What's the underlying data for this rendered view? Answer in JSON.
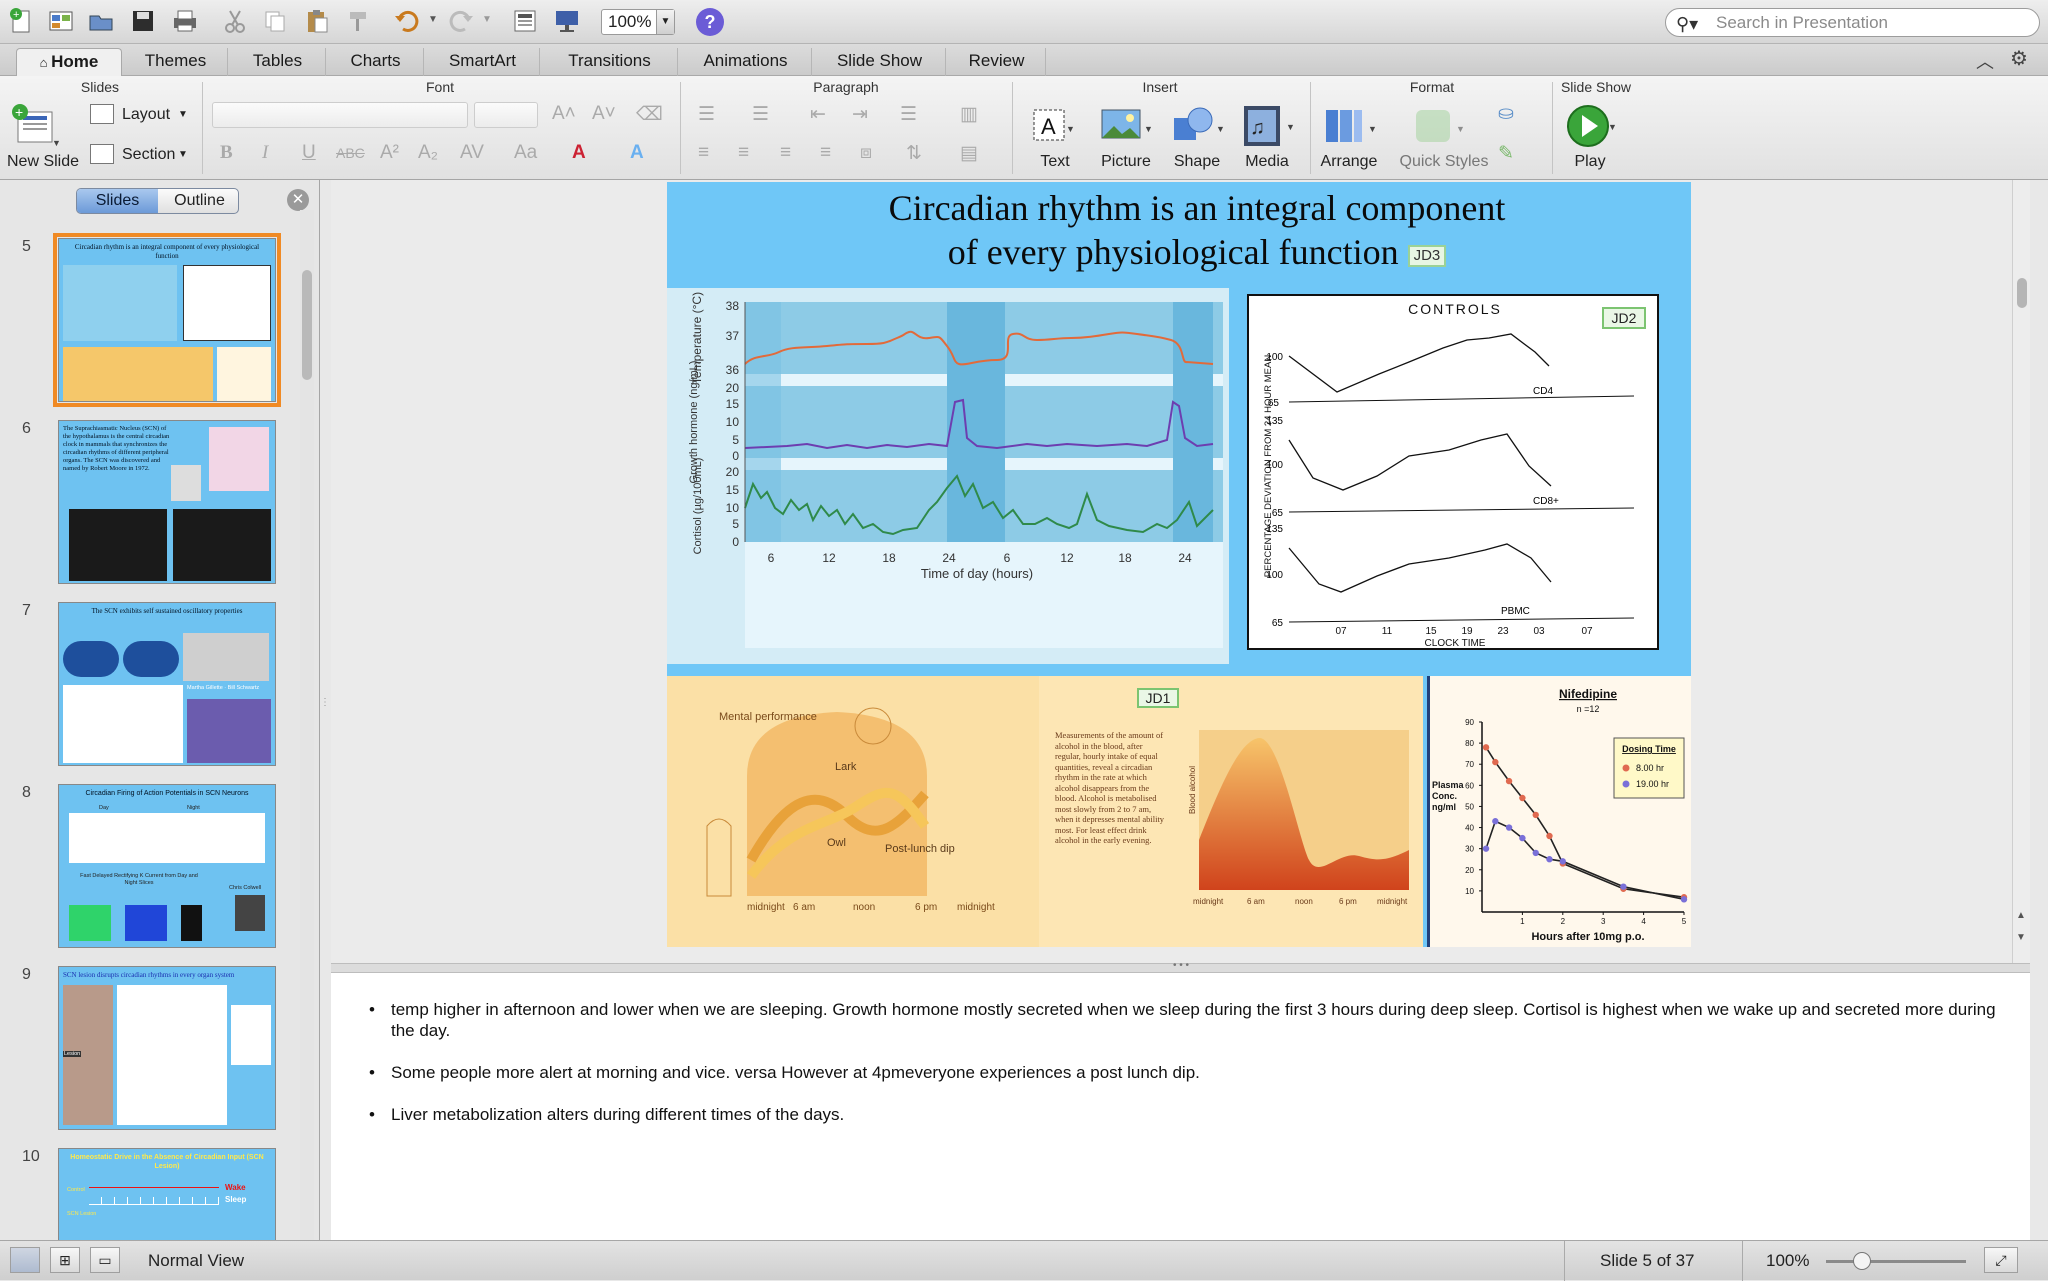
{
  "toolbar": {
    "zoom": "100%",
    "help_label": "?",
    "search_placeholder": "Search in Presentation",
    "icons": [
      "new-icon",
      "template-icon",
      "open-icon",
      "save-icon",
      "print-icon",
      "cut-icon",
      "copy-icon",
      "paste-icon",
      "format-painter-icon",
      "undo-icon",
      "redo-icon",
      "slide-layout-icon",
      "slideshow-icon"
    ]
  },
  "tabs": [
    "Home",
    "Themes",
    "Tables",
    "Charts",
    "SmartArt",
    "Transitions",
    "Animations",
    "Slide Show",
    "Review"
  ],
  "ribbon": {
    "groups": {
      "slides": "Slides",
      "font": "Font",
      "paragraph": "Paragraph",
      "insert": "Insert",
      "format": "Format",
      "slideshow": "Slide Show"
    },
    "new_slide": "New Slide",
    "layout": "Layout",
    "section": "Section",
    "font_buttons": {
      "bold": "B",
      "italic": "I",
      "underline": "U",
      "strike": "ABC",
      "superscript": "A²",
      "subscript": "A₂"
    },
    "insert_items": [
      "Text",
      "Picture",
      "Shape",
      "Media"
    ],
    "arrange": "Arrange",
    "quick_styles": "Quick Styles",
    "play": "Play"
  },
  "sidebar": {
    "view_slides": "Slides",
    "view_outline": "Outline",
    "thumbnails": [
      {
        "num": "5",
        "title": "Circadian rhythm is an integral component of every physiological function",
        "selected": true
      },
      {
        "num": "6",
        "title": "The Suprachiasmatic Nucleus (SCN) of the hypothalamus is the central circadian clock in mammals that synchronizes the circadian rhythms of different peripheral organs. The SCN was discovered and named by Robert Moore in 1972."
      },
      {
        "num": "7",
        "title": "The SCN exhibits self sustained oscillatory properties",
        "names": [
          "Martha Gillette",
          "Bill Schwartz"
        ]
      },
      {
        "num": "8",
        "title": "Circadian Firing of Action Potentials in SCN Neurons",
        "sub": "Fast Delayed Rectifying K Current from Day and Night Slices",
        "labels": [
          "Day",
          "Night"
        ],
        "author": "Chris Colwell"
      },
      {
        "num": "9",
        "title": "SCN lesion disrupts circadian rhythms in every organ system",
        "label": "Lesion"
      },
      {
        "num": "10",
        "title": "Homeostatic Drive in the Absence of Circadian Input (SCN Lesion)",
        "labels": [
          "Wake",
          "Sleep",
          "Control",
          "SCN Lesion"
        ]
      }
    ]
  },
  "slide": {
    "title_line1": "Circadian rhythm is an integral component",
    "title_line2": "of every physiological function",
    "tag_jd3": "JD3",
    "tag_jd2": "JD2",
    "tag_jd1": "JD1",
    "physio": {
      "ylabels": [
        "Temperature (°C)",
        "Growth hormone (ng/mL)",
        "Cortisol (µg/100mL)"
      ],
      "temp_ticks": [
        "38",
        "37",
        "36"
      ],
      "gh_ticks": [
        "20",
        "15",
        "10",
        "5",
        "0"
      ],
      "cort_ticks": [
        "20",
        "15",
        "10",
        "5",
        "0"
      ],
      "xticks": [
        "6",
        "12",
        "18",
        "24",
        "6",
        "12",
        "18",
        "24"
      ],
      "xlabel": "Time of day (hours)"
    },
    "controls": {
      "title": "CONTROLS",
      "ylabel": "PERCENTAGE DEVIATION FROM 24 HOUR MEAN",
      "xlabel": "CLOCK TIME",
      "xticks": [
        "07",
        "11",
        "15",
        "19",
        "23",
        "03",
        "07"
      ],
      "panels": [
        {
          "name": "CD4",
          "ticks": [
            "100",
            "65"
          ]
        },
        {
          "name": "CD8+",
          "ticks": [
            "135",
            "100",
            "65"
          ]
        },
        {
          "name": "PBMC",
          "ticks": [
            "135",
            "100",
            "65"
          ]
        }
      ]
    },
    "mental": {
      "title": "Mental performance",
      "lark": "Lark",
      "owl": "Owl",
      "dip": "Post-lunch dip",
      "xticks": [
        "midnight",
        "6 am",
        "noon",
        "6 pm",
        "midnight"
      ]
    },
    "alcohol": {
      "caption": "Measurements of the amount of alcohol in the blood, after regular, hourly intake of equal quantities, reveal a circadian rhythm in the rate at which alcohol disappears from the blood. Alcohol is metabolised most slowly from 2 to 7 am, when it depresses mental ability most. For least effect drink alcohol in the early evening.",
      "ylabel": "Blood alcohol",
      "xticks": [
        "midnight",
        "6 am",
        "noon",
        "6 pm",
        "midnight"
      ]
    }
  },
  "chart_data": {
    "type": "line",
    "title": "Nifedipine",
    "subtitle": "n =12",
    "xlabel": "Hours after 10mg p.o.",
    "ylabel": "Plasma Conc. ng/ml",
    "ylim": [
      0,
      90
    ],
    "xlim": [
      0,
      5
    ],
    "yticks": [
      "90",
      "80",
      "70",
      "60",
      "50",
      "40",
      "30",
      "20",
      "10"
    ],
    "xticks": [
      "1",
      "2",
      "3",
      "4",
      "5"
    ],
    "legend_title": "Dosing Time",
    "legend_position": "top-right",
    "series": [
      {
        "name": "8.00 hr",
        "color": "#e06a50",
        "x": [
          0.1,
          0.33,
          0.67,
          1,
          1.33,
          1.67,
          2,
          3.5,
          5
        ],
        "y": [
          78,
          71,
          62,
          54,
          46,
          36,
          23,
          11,
          7
        ]
      },
      {
        "name": "19.00 hr",
        "color": "#7a70d8",
        "x": [
          0.1,
          0.33,
          0.67,
          1,
          1.33,
          1.67,
          2,
          3.5,
          5
        ],
        "y": [
          30,
          43,
          40,
          35,
          28,
          25,
          24,
          12,
          6
        ]
      }
    ]
  },
  "notes": [
    "temp higher in afternoon and lower when we are sleeping. Growth hormone mostly secreted when we sleep during the first 3 hours during deep sleep. Cortisol is highest when we wake up and secreted more during the day.",
    "Some people more alert at morning and vice. versa  However at 4pmeveryone experiences a post lunch dip.",
    "Liver metabolization alters during different times of the days."
  ],
  "status": {
    "view": "Normal View",
    "slide_position": "Slide 5 of 37",
    "zoom": "100%"
  }
}
